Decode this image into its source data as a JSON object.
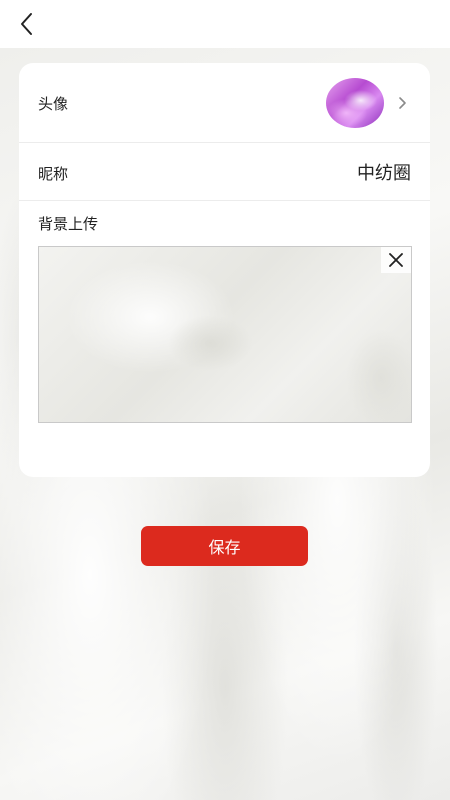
{
  "profile": {
    "avatar_label": "头像",
    "nickname_label": "昵称",
    "nickname_value": "中纺圈",
    "background_label": "背景上传"
  },
  "actions": {
    "save_label": "保存"
  },
  "icons": {
    "back": "chevron-left-icon",
    "avatar_arrow": "chevron-right-icon",
    "remove_image": "close-icon"
  },
  "colors": {
    "primary_button": "#dc2a1e",
    "card_background": "#ffffff"
  }
}
